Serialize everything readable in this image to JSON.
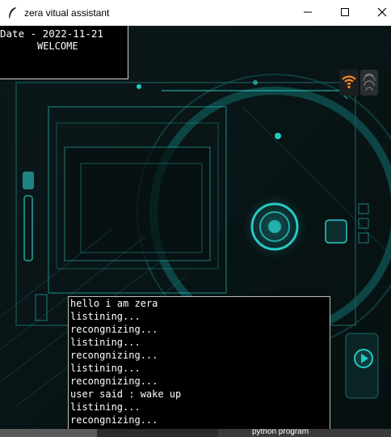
{
  "window": {
    "title": "zera vitual assistant"
  },
  "header": {
    "date_text": "Date - 2022-11-21",
    "welcome_text": "WELCOME"
  },
  "console": {
    "lines": [
      "hello i am zera",
      "listining...",
      "recongnizing...",
      "listining...",
      "recongnizing...",
      "listining...",
      "recongnizing...",
      "user said : wake up",
      "listining...",
      "recongnizing..."
    ]
  },
  "taskbar": {
    "item_label": "python program"
  },
  "colors": {
    "accent": "#27c9c4",
    "accent_dark": "#0f5a5a",
    "wifi": "#ff8a1c"
  },
  "icons": [
    "feather-icon",
    "minimize-icon",
    "maximize-icon",
    "close-icon",
    "wifi-icon",
    "fingerprint-icon",
    "play-icon"
  ]
}
